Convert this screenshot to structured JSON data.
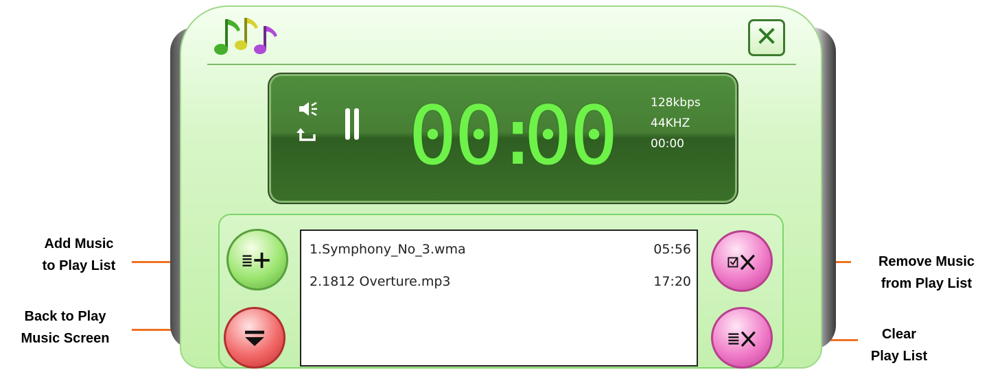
{
  "annotations": {
    "add_music": [
      "Add Music",
      "to Play List"
    ],
    "back_to_play": [
      "Back to Play",
      "Music Screen"
    ],
    "remove_music": [
      "Remove Music",
      "from Play List"
    ],
    "clear_list": [
      "Clear",
      "Play List"
    ]
  },
  "window": {
    "logo_icon": "music-notes-icon",
    "close_label": "✕"
  },
  "lcd": {
    "time_minutes": "00",
    "time_separator": ":",
    "time_seconds": "00",
    "bitrate": "128kbps",
    "sample_rate": "44KHZ",
    "total_time": "00:00",
    "volume_icon": "speaker-icon",
    "repeat_icon": "repeat-icon",
    "state_icon": "pause-icon"
  },
  "buttons": {
    "add": "list-add-icon",
    "back": "arrow-down-icon",
    "remove": "checkbox-remove-icon",
    "clear": "list-clear-icon"
  },
  "playlist": {
    "tracks": [
      {
        "name": "1.Symphony_No_3.wma",
        "duration": "05:56"
      },
      {
        "name": "2.1812 Overture.mp3",
        "duration": "17:20"
      }
    ]
  },
  "colors": {
    "accent_arrow": "#f07020",
    "lcd_digits": "#6ef24a",
    "frame_green": "#c2f0a8"
  }
}
